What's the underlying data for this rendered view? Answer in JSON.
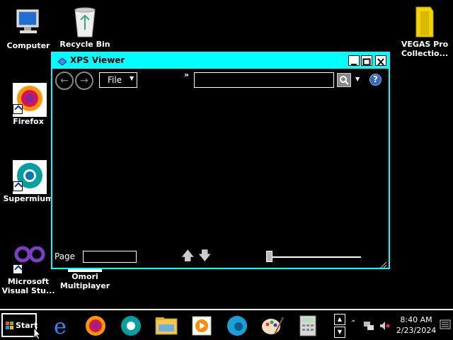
{
  "desktop": {
    "icons": [
      {
        "label": "Computer"
      },
      {
        "label": "Recycle Bin"
      },
      {
        "label": "VEGAS Pro Collectio..."
      },
      {
        "label": "Firefox"
      },
      {
        "label": "Supermium"
      },
      {
        "label": "Microsoft Visual Stu..."
      },
      {
        "label": "Omori Multiplayer"
      }
    ]
  },
  "window": {
    "title": "XPS Viewer",
    "toolbar": {
      "file_label": "File",
      "search_placeholder": "",
      "search_value": "",
      "overflow_glyph": "»",
      "help_glyph": "?"
    },
    "statusbar": {
      "page_label": "Page",
      "page_value": ""
    },
    "zoom_slider_fraction": 0.0
  },
  "taskbar": {
    "start_label": "Start",
    "pinned_icons": [
      "internet-explorer-icon",
      "firefox-icon",
      "supermium-icon",
      "file-explorer-icon",
      "media-player-icon",
      "edge-icon",
      "paint-icon",
      "calculator-icon"
    ],
    "clock": {
      "time": "8:40 AM",
      "date": "2/23/2024"
    },
    "tray_icons": [
      "show-hidden-icons",
      "network-icon",
      "volume-muted-icon",
      "action-center-icon"
    ]
  },
  "colors": {
    "accent_titlebar": "#00ffff",
    "background": "#000000"
  }
}
